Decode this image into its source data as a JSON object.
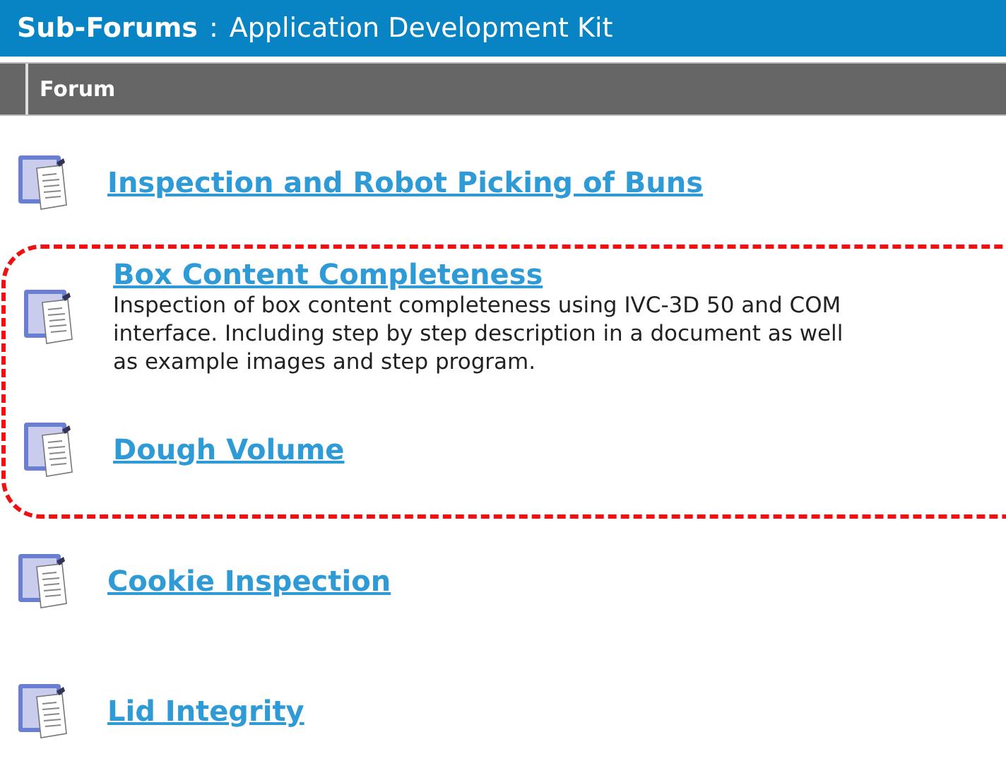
{
  "header": {
    "title": "Sub-Forums",
    "separator": ":",
    "subtitle": "Application Development Kit"
  },
  "table": {
    "columns": [
      "Forum"
    ]
  },
  "forums": [
    {
      "title": "Inspection and Robot Picking of Buns",
      "highlighted": false
    },
    {
      "title": "Box Content Completeness",
      "description_lines": [
        "Inspection of box content completeness using IVC-3D 50 and COM",
        "interface. Including step by step description in a document as well",
        "as example images and step program."
      ],
      "highlighted": true
    },
    {
      "title": "Dough Volume",
      "highlighted": true
    },
    {
      "title": "Cookie Inspection",
      "highlighted": false
    },
    {
      "title": "Lid Integrity",
      "highlighted": false
    }
  ]
}
